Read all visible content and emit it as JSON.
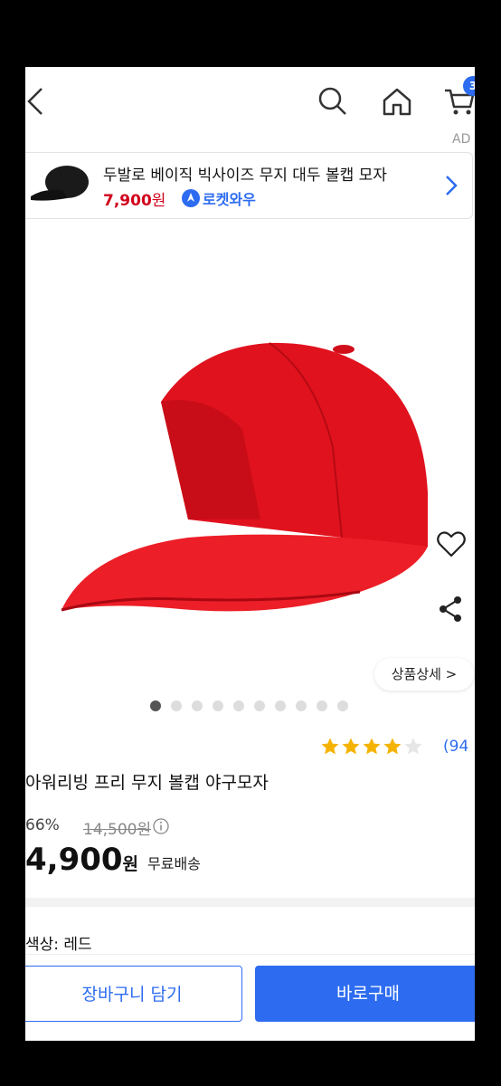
{
  "header": {
    "cart_count": "3",
    "ad_label": "AD"
  },
  "ad_card": {
    "title": "두발로 베이직 빅사이즈 무지 대두 볼캡 모자",
    "price": "7,900",
    "currency": "원",
    "badge": "로켓와우"
  },
  "gallery": {
    "detail_button": "상품상세 >",
    "image_count": 10,
    "active_index": 0
  },
  "product": {
    "rating_stars": 4,
    "rating_count": "(94",
    "title": "아워리빙 프리 무지 볼캡 야구모자",
    "discount": "66%",
    "original_price": "14,500원",
    "sale_price": "4,900",
    "currency": "원",
    "shipping": "무료배송",
    "option": "색상: 레드"
  },
  "actions": {
    "add_to_cart": "장바구니 담기",
    "buy_now": "바로구매"
  },
  "colors": {
    "accent": "#2d6cf0",
    "price_red": "#d0021b",
    "star": "#f5b301",
    "cap_red": "#e0121e"
  }
}
